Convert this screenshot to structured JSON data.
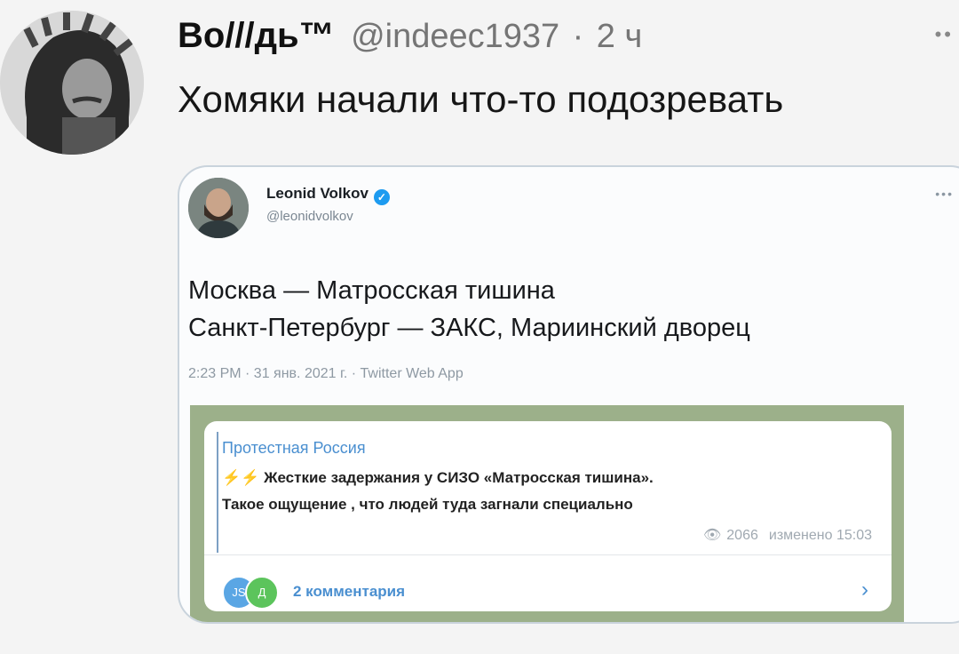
{
  "tweet": {
    "author_name": "Во///дь™",
    "author_handle": "@indeec1937",
    "separator": "·",
    "time": "2 ч",
    "text": "Хомяки начали что-то подозревать"
  },
  "embedded_tweet": {
    "name": "Leonid Volkov",
    "handle": "@leonidvolkov",
    "line1": "Москва — Матросская тишина",
    "line2": "Санкт-Петербург — ЗАКС, Мариинский дворец",
    "meta": "2:23 PM · 31 янв. 2021 г. · Twitter Web App"
  },
  "telegram_post": {
    "channel": "Протестная Россия",
    "bolts": "⚡⚡",
    "line1": "Жесткие задержания у СИЗО «Матросская тишина».",
    "line2": "Такое ощущение , что людей туда загнали специально",
    "views": "2066",
    "edited": "изменено 15:03",
    "avatar1": "JS",
    "avatar2": "Д",
    "comments": "2 комментария"
  },
  "colors": {
    "accent_blue": "#1d9bf0",
    "telegram_link": "#4a8fd0",
    "telegram_bg": "#9cb08a"
  }
}
